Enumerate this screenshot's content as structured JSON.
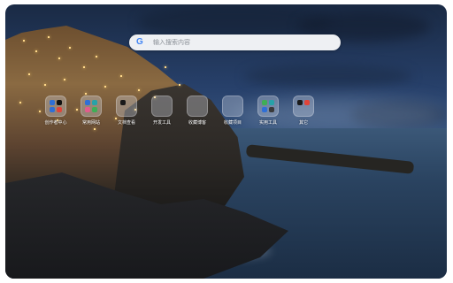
{
  "search": {
    "placeholder": "输入搜索内容",
    "engine_icon": "google-icon",
    "engine_glyph": "G"
  },
  "apps": [
    {
      "label": "创作者中心",
      "icons": [
        "blue-app-icon",
        "tiktok-icon",
        "blue-app-icon",
        "red-app-icon"
      ]
    },
    {
      "label": "常用网站",
      "icons": [
        "blue-app-icon",
        "teal-app-icon",
        "pink-app-icon",
        "green-app-icon"
      ]
    },
    {
      "label": "文档查看",
      "icons": [
        "black-app-icon"
      ]
    },
    {
      "label": "开发工具",
      "icons": []
    },
    {
      "label": "收藏博客",
      "icons": []
    },
    {
      "label": "收藏项目",
      "icons": []
    },
    {
      "label": "实用工具",
      "icons": [
        "green-app-icon",
        "teal-app-icon",
        "blue-app-icon",
        "dark-app-icon"
      ]
    },
    {
      "label": "其它",
      "icons": [
        "black-app-icon",
        "red-app-icon"
      ]
    }
  ],
  "colors": {
    "search_bg": "#eef0f3",
    "google_blue": "#4285f4",
    "label_text": "#ffffff"
  }
}
